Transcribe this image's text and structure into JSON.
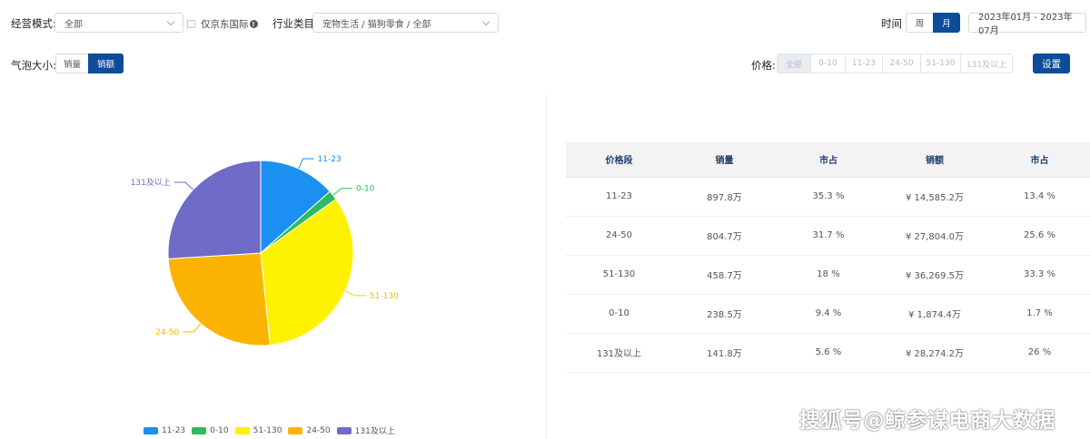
{
  "filters": {
    "mode_label": "经营模式:",
    "mode_value": "全部",
    "jd_intl_label": "仅京东国际",
    "category_label": "行业类目",
    "category_value": "宠物生活 / 猫狗零食 / 全部",
    "time_label": "时间",
    "time_options": [
      "周",
      "月"
    ],
    "time_active": "月",
    "date_range": "2023年01月 - 2023年07月",
    "bubble_label": "气泡大小:",
    "bubble_options": [
      "销量",
      "销额"
    ],
    "bubble_active": "销额",
    "price_label": "价格:",
    "price_options": [
      "全部",
      "0-10",
      "11-23",
      "24-50",
      "51-130",
      "131及以上"
    ],
    "price_selected": "全部",
    "settings_label": "设置"
  },
  "colors": {
    "primary": "#0c4c98",
    "seg_11_23": "#1b8ff2",
    "seg_0_10": "#2dbb5d",
    "seg_51_130": "#fff200",
    "seg_24_50": "#fdb302",
    "seg_131_up": "#6f6bc6"
  },
  "chart_data": {
    "type": "pie",
    "slices": [
      {
        "name": "11-23",
        "value": 13.4,
        "color": "#1b8ff2"
      },
      {
        "name": "0-10",
        "value": 1.7,
        "color": "#2dbb5d"
      },
      {
        "name": "51-130",
        "value": 33.3,
        "color": "#fff200"
      },
      {
        "name": "24-50",
        "value": 25.6,
        "color": "#fdb302"
      },
      {
        "name": "131及以上",
        "value": 26.0,
        "color": "#6f6bc6"
      }
    ],
    "legend": [
      "11-23",
      "0-10",
      "51-130",
      "24-50",
      "131及以上"
    ],
    "legend_position": "bottom"
  },
  "table": {
    "headers": [
      "价格段",
      "销量",
      "市占",
      "销额",
      "市占"
    ],
    "rows": [
      [
        "11-23",
        "897.8万",
        "35.3 %",
        "¥ 14,585.2万",
        "13.4 %"
      ],
      [
        "24-50",
        "804.7万",
        "31.7 %",
        "¥ 27,804.0万",
        "25.6 %"
      ],
      [
        "51-130",
        "458.7万",
        "18 %",
        "¥ 36,269.5万",
        "33.3 %"
      ],
      [
        "0-10",
        "238.5万",
        "9.4 %",
        "¥ 1,874.4万",
        "1.7 %"
      ],
      [
        "131及以上",
        "141.8万",
        "5.6 %",
        "¥ 28,274.2万",
        "26 %"
      ]
    ]
  },
  "watermark": "搜狐号@鲸参谋电商大数据"
}
